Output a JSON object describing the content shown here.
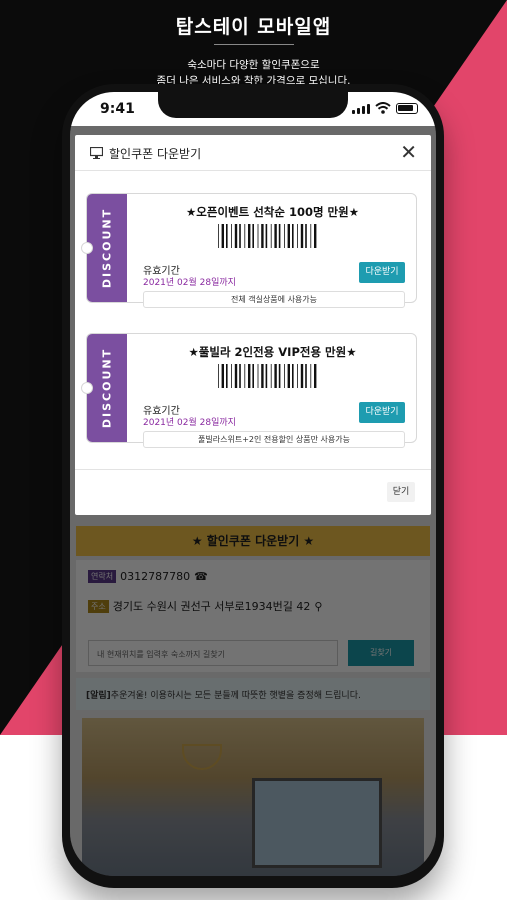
{
  "promo": {
    "title": "탑스테이 모바일앱",
    "subtitle_line1": "숙소마다 다양한 할인쿠폰으로",
    "subtitle_line2": "좀더 나은 서비스와 착한 가격으로 모십니다."
  },
  "status_bar": {
    "time": "9:41"
  },
  "modal": {
    "title": "할인쿠폰 다운받기",
    "close_icon": "close-icon",
    "footer_close_label": "닫기",
    "coupons": [
      {
        "side_label": "DISCOUNT",
        "title": "★오픈이벤트 선착순 100명 만원★",
        "valid_label": "유효기간",
        "valid_date": "2021년 02월 28일까지",
        "download_label": "다운받기",
        "note": "전체 객실상품에 사용가능"
      },
      {
        "side_label": "DISCOUNT",
        "title": "★풀빌라 2인전용 VIP전용 만원★",
        "valid_label": "유효기간",
        "valid_date": "2021년 02월 28일까지",
        "download_label": "다운받기",
        "note": "풀빌라스위트+2인 전용할인 상품만 사용가능"
      }
    ]
  },
  "background_page": {
    "coupon_banner": "★ 할인쿠폰 다운받기 ★",
    "phone_tag": "연락처",
    "phone_number": "0312787780",
    "address_tag": "주소",
    "address": "경기도 수원시 권선구 서부로1934번길 42",
    "route_placeholder": "내 현재위치를 입력후 숙소까지 길찾기",
    "route_button": "길찾기",
    "notice_tag": "[알림]",
    "notice_text": "추운겨울! 이용하시는 모든 분들께 따뜻한 햇볕을 증정해 드립니다."
  },
  "colors": {
    "pink": "#e2456a",
    "purple": "#7b4fa0",
    "teal": "#1e9cb0",
    "yellow": "#f2c247"
  }
}
